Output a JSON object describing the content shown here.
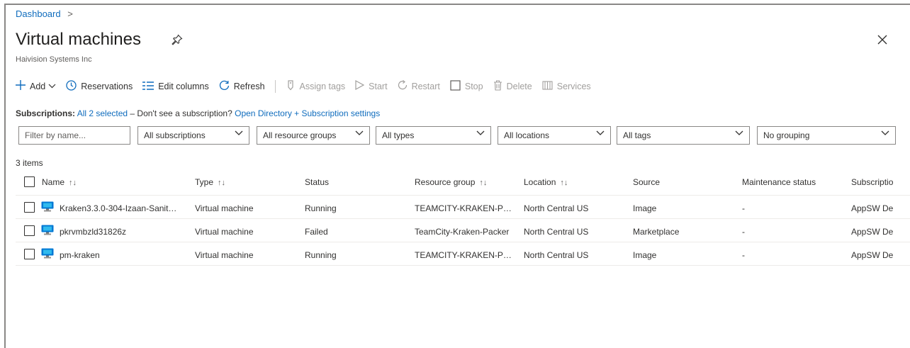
{
  "breadcrumb": {
    "root": "Dashboard",
    "separator": ">"
  },
  "page": {
    "title": "Virtual machines",
    "subtitle": "Haivision Systems Inc"
  },
  "icons": {
    "pin": "pin-icon",
    "close": "close-icon",
    "vm": "virtual-machine-icon"
  },
  "toolbar": {
    "add": "Add",
    "reservations": "Reservations",
    "edit_columns": "Edit columns",
    "refresh": "Refresh",
    "assign_tags": "Assign tags",
    "start": "Start",
    "restart": "Restart",
    "stop": "Stop",
    "delete": "Delete",
    "services": "Services"
  },
  "subscriptions": {
    "label": "Subscriptions:",
    "selected": "All 2 selected",
    "question": "– Don't see a subscription?",
    "link": "Open Directory + Subscription settings"
  },
  "filters": {
    "name_placeholder": "Filter by name...",
    "subscriptions": "All subscriptions",
    "resource_groups": "All resource groups",
    "types": "All types",
    "locations": "All locations",
    "tags": "All tags",
    "grouping": "No grouping"
  },
  "list": {
    "count": "3 items",
    "columns": {
      "name": "Name",
      "type": "Type",
      "status": "Status",
      "resource_group": "Resource group",
      "location": "Location",
      "source": "Source",
      "maintenance": "Maintenance status",
      "subscription": "Subscriptio"
    },
    "rows": [
      {
        "name": "Kraken3.3.0-304-Izaan-Sanit…",
        "type": "Virtual machine",
        "status": "Running",
        "resource_group": "TEAMCITY-KRAKEN-P…",
        "location": "North Central US",
        "source": "Image",
        "maintenance": "-",
        "subscription": "AppSW De"
      },
      {
        "name": "pkrvmbzld31826z",
        "type": "Virtual machine",
        "status": "Failed",
        "resource_group": "TeamCity-Kraken-Packer",
        "location": "North Central US",
        "source": "Marketplace",
        "maintenance": "-",
        "subscription": "AppSW De"
      },
      {
        "name": "pm-kraken",
        "type": "Virtual machine",
        "status": "Running",
        "resource_group": "TEAMCITY-KRAKEN-P…",
        "location": "North Central US",
        "source": "Image",
        "maintenance": "-",
        "subscription": "AppSW De"
      }
    ]
  },
  "colors": {
    "link": "#0f6cbd",
    "text": "#323130",
    "disabled": "#a19f9d",
    "border": "#8a8886"
  }
}
